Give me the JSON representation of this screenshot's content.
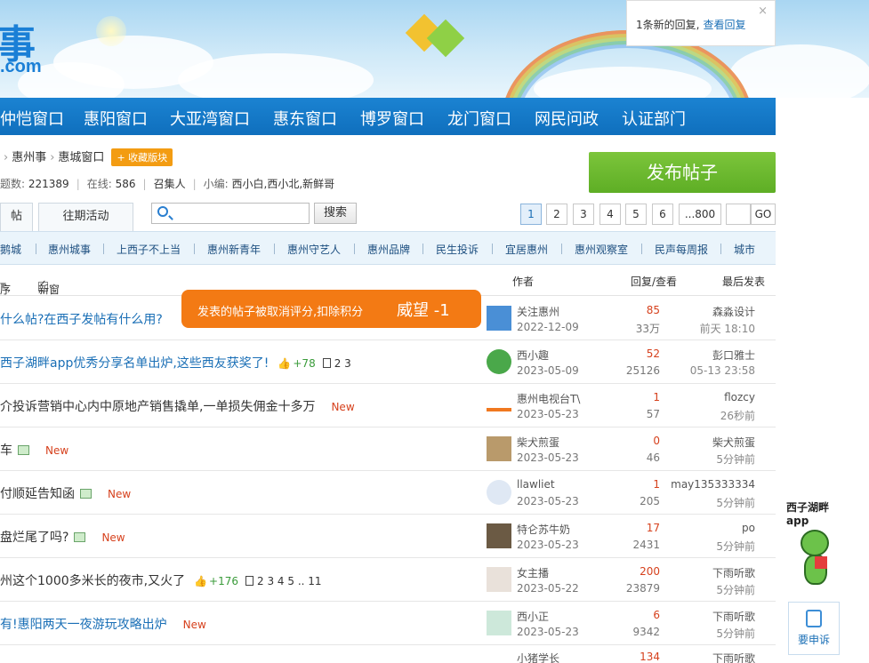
{
  "notice": {
    "text": "1条新的回复,",
    "link": "查看回复",
    "close": "×"
  },
  "logo": {
    "char": "事",
    "suffix": ".com"
  },
  "nav": [
    "仲恺窗口",
    "惠阳窗口",
    "大亚湾窗口",
    "惠东窗口",
    "博罗窗口",
    "龙门窗口",
    "网民问政",
    "认证部门"
  ],
  "breadcrumb": {
    "items": [
      "惠州事",
      "惠城窗口"
    ],
    "fav": "+ 收藏版块"
  },
  "stats": {
    "posts_label": "题数:",
    "posts": "221389",
    "online_label": "在线:",
    "online": "586",
    "convener": "召集人",
    "editor_label": "小编:",
    "editors": "西小白,西小北,新鲜哥"
  },
  "post_button": "发布帖子",
  "tabs": [
    "帖",
    "往期活动"
  ],
  "search": {
    "placeholder": "",
    "button": "搜索"
  },
  "pager": [
    "1",
    "2",
    "3",
    "4",
    "5",
    "6",
    "...800",
    "",
    "GO"
  ],
  "categories": [
    "鹅城",
    "惠州城事",
    "上西子不上当",
    "惠州新青年",
    "惠州守艺人",
    "惠州品牌",
    "民生投诉",
    "宜居惠州",
    "惠州观察室",
    "民声每周报",
    "城市"
  ],
  "table_header": {
    "sort": "序",
    "new_window": "新窗",
    "author": "作者",
    "reply_view": "回复/查看",
    "last_post": "最后发表"
  },
  "toast": {
    "message": "发表的帖子被取消评分,扣除积分",
    "points": "威望 -1"
  },
  "rows": [
    {
      "title": "什么帖?在西子发帖有什么用?",
      "author": "关注惠州",
      "date": "2022-12-09",
      "replies": "85",
      "views": "33万",
      "last_user": "森淼设计",
      "last_time": "前天 18:10"
    },
    {
      "title": "西子湖畔app优秀分享名单出炉,这些西友获奖了!",
      "thumb": "+78",
      "pages": "2 3",
      "author": "西小趣",
      "date": "2023-05-09",
      "replies": "52",
      "views": "25126",
      "last_user": "彭口雅士",
      "last_time": "05-13 23:58"
    },
    {
      "title": "介投诉营销中心内中原地产销售撬单,一单损失佣金十多万",
      "new": "New",
      "author": "惠州电视台T\\",
      "date": "2023-05-23",
      "replies": "1",
      "views": "57",
      "last_user": "flozcy",
      "last_time": "26秒前"
    },
    {
      "title": "车",
      "new": "New",
      "author": "柴犬煎蛋",
      "date": "2023-05-23",
      "replies": "0",
      "views": "46",
      "last_user": "柴犬煎蛋",
      "last_time": "5分钟前"
    },
    {
      "title": "付顺延告知函",
      "new": "New",
      "author": "llawliet",
      "date": "2023-05-23",
      "replies": "1",
      "views": "205",
      "last_user": "may135333334",
      "last_time": "5分钟前"
    },
    {
      "title": "盘烂尾了吗?",
      "new": "New",
      "author": "特仑苏牛奶",
      "date": "2023-05-23",
      "replies": "17",
      "views": "2431",
      "last_user": "po",
      "last_time": "5分钟前"
    },
    {
      "title": "州这个1000多米长的夜市,又火了",
      "thumb": "+176",
      "pages": "2 3 4 5 .. 11",
      "author": "女主播",
      "date": "2023-05-22",
      "replies": "200",
      "views": "23879",
      "last_user": "下雨听歌",
      "last_time": "5分钟前"
    },
    {
      "title": "有!惠阳两天一夜游玩攻略出炉",
      "new": "New",
      "author": "西小正",
      "date": "2023-05-23",
      "replies": "6",
      "views": "9342",
      "last_user": "下雨听歌",
      "last_time": "5分钟前"
    },
    {
      "title": "",
      "author": "小猪学长",
      "date": "",
      "replies": "134",
      "views": "",
      "last_user": "下雨听歌",
      "last_time": ""
    }
  ],
  "side": {
    "app_line1": "西子湖畔",
    "app_line2": "app",
    "complain": "要申诉"
  }
}
